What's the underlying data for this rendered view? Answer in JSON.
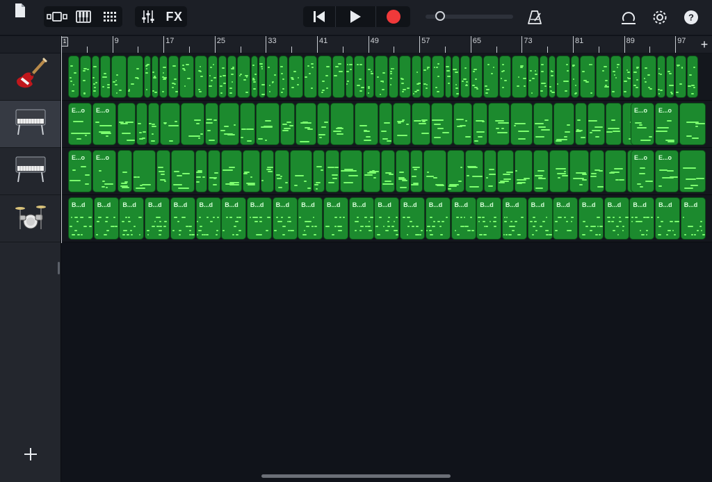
{
  "toolbar": {
    "fx_label": "FX",
    "icons": {
      "my_songs": "document-icon",
      "tracks_view": "tracks-view-icon",
      "keyboard": "piano-keyboard-icon",
      "grid": "grid-icon",
      "mixer": "mixer-sliders-icon",
      "rewind": "go-to-start-icon",
      "play": "play-icon",
      "record": "record-icon",
      "metronome": "metronome-icon",
      "loop": "loop-browser-icon",
      "settings": "gear-icon",
      "help": "help-icon"
    },
    "record_color": "#f0393a"
  },
  "ruler": {
    "bars": [
      "1",
      "9",
      "17",
      "25",
      "33",
      "41",
      "49",
      "57",
      "65",
      "73",
      "81",
      "89",
      "97"
    ],
    "add_section_label": "+"
  },
  "tracks": [
    {
      "instrument": "bass-guitar-icon",
      "regions": []
    },
    {
      "instrument": "electric-piano-icon",
      "selected": true,
      "regions": [
        {
          "label": "E...o"
        },
        {
          "label": "E...o"
        },
        {
          "label": "E...o"
        },
        {
          "label": "E...o"
        }
      ]
    },
    {
      "instrument": "electric-piano-icon",
      "regions": [
        {
          "label": "E...o"
        },
        {
          "label": "E...o"
        },
        {
          "label": "E...o"
        },
        {
          "label": "E...o"
        }
      ]
    },
    {
      "instrument": "drum-kit-icon",
      "regions": [
        {
          "label": "B...d"
        },
        {
          "label": "B...d"
        },
        {
          "label": "B...d"
        },
        {
          "label": "B...d"
        },
        {
          "label": "B...d"
        },
        {
          "label": "B...d"
        },
        {
          "label": "B...d"
        },
        {
          "label": "B...d"
        },
        {
          "label": "B...d"
        },
        {
          "label": "B...d"
        },
        {
          "label": "B...d"
        },
        {
          "label": "B...d"
        },
        {
          "label": "B...d"
        },
        {
          "label": "B...d"
        },
        {
          "label": "B...d"
        },
        {
          "label": "B...d"
        },
        {
          "label": "B...d"
        },
        {
          "label": "B...d"
        },
        {
          "label": "B...d"
        },
        {
          "label": "B...d"
        },
        {
          "label": "B...d"
        },
        {
          "label": "B...d"
        },
        {
          "label": "B...d"
        },
        {
          "label": "B...d"
        },
        {
          "label": "B...d"
        }
      ]
    }
  ],
  "add_track_label": "+",
  "colors": {
    "region_green": "#1c8a2e",
    "note_green": "#7dff6f",
    "background": "#10131a"
  }
}
